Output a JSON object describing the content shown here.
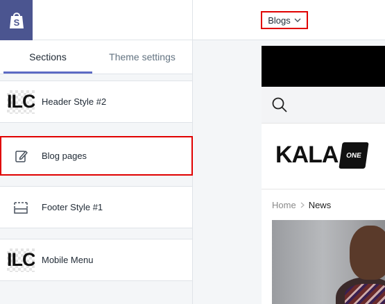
{
  "header": {
    "page_selector": {
      "label": "Blogs",
      "icon": "chevron-down-icon"
    }
  },
  "sidebar": {
    "tabs": [
      {
        "label": "Sections",
        "active": true
      },
      {
        "label": "Theme settings",
        "active": false
      }
    ],
    "sections": [
      {
        "label": "Header Style #2",
        "icon": "ilc-logo-thumbnail"
      },
      {
        "label": "Blog pages",
        "icon": "edit-page-icon",
        "highlighted": true
      },
      {
        "label": "Footer Style #1",
        "icon": "footer-layout-icon"
      },
      {
        "label": "Mobile Menu",
        "icon": "ilc-logo-thumbnail"
      }
    ],
    "thumbnail_text": "ILC"
  },
  "preview": {
    "brand_logo_text": "KALA",
    "brand_badge_text": "ONE",
    "breadcrumb": {
      "home": "Home",
      "current": "News"
    }
  },
  "colors": {
    "logo_bg": "#4b5590",
    "highlight_border": "#e00000",
    "tab_accent": "#5c6ac4"
  }
}
